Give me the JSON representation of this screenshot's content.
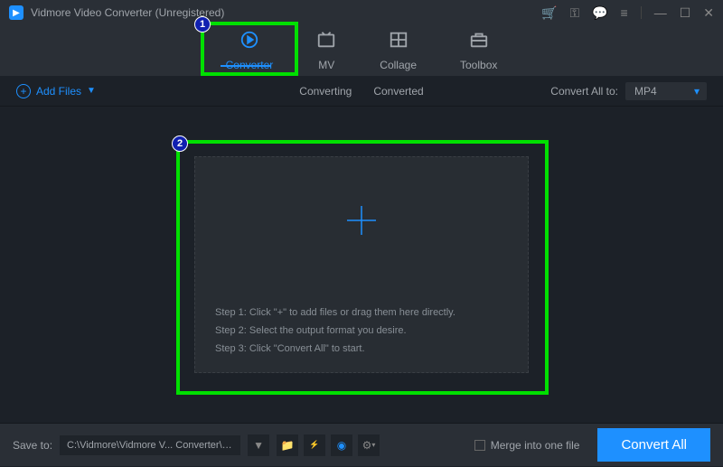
{
  "titlebar": {
    "title": "Vidmore Video Converter (Unregistered)"
  },
  "tabs": {
    "converter": "Converter",
    "mv": "MV",
    "collage": "Collage",
    "toolbox": "Toolbox"
  },
  "toolbar": {
    "add_files": "Add Files",
    "sub_converting": "Converting",
    "sub_converted": "Converted",
    "convert_all_to": "Convert All to:",
    "format": "MP4"
  },
  "dropzone": {
    "step1": "Step 1: Click \"+\" to add files or drag them here directly.",
    "step2": "Step 2: Select the output format you desire.",
    "step3": "Step 3: Click \"Convert All\" to start."
  },
  "footer": {
    "save_to_label": "Save to:",
    "save_path": "C:\\Vidmore\\Vidmore V... Converter\\Converted",
    "merge": "Merge into one file",
    "convert_all": "Convert All"
  },
  "annotations": {
    "one": "1",
    "two": "2"
  }
}
